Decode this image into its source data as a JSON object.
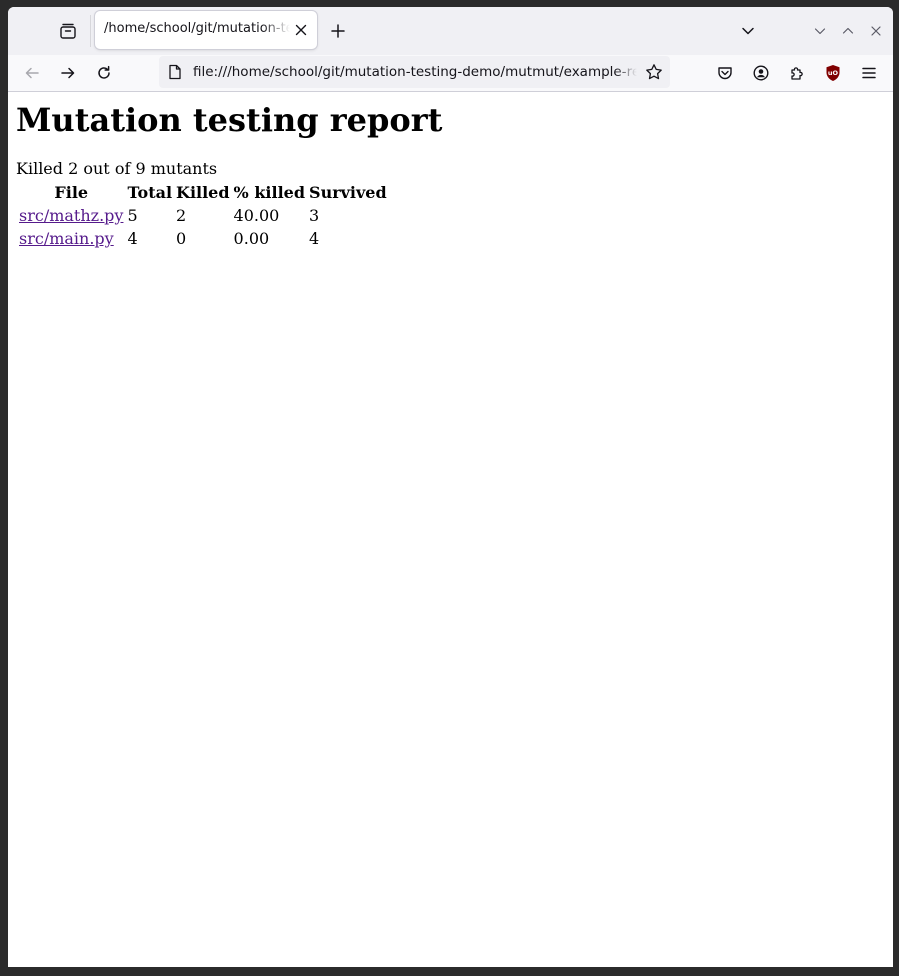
{
  "browser": {
    "tab": {
      "title": "/home/school/git/mutation-testing-demo/mutmut/example-report.html"
    },
    "url": "file:///home/school/git/mutation-testing-demo/mutmut/example-report.html",
    "colors": {
      "tab_strip_bg": "#f0f0f4",
      "toolbar_bg": "#f9f9fb",
      "ublock_red": "#800000",
      "link_visited": "#551a8b"
    }
  },
  "page": {
    "heading": "Mutation testing report",
    "summary": "Killed 2 out of 9 mutants",
    "table": {
      "headers": {
        "file": "File",
        "total": "Total",
        "killed": "Killed",
        "pct": "% killed",
        "survived": "Survived"
      },
      "rows": [
        {
          "file": "src/mathz.py",
          "total": "5",
          "killed": "2",
          "pct": "40.00",
          "survived": "3"
        },
        {
          "file": "src/main.py",
          "total": "4",
          "killed": "0",
          "pct": "0.00",
          "survived": "4"
        }
      ]
    }
  },
  "icons": {
    "tab_overview": "firefox-view-icon",
    "tab_close": "close-icon",
    "new_tab": "plus-icon",
    "tab_list": "chevron-down-icon",
    "back": "back-arrow-icon",
    "forward": "forward-arrow-icon",
    "reload": "reload-icon",
    "page_info": "file-page-icon",
    "bookmark": "star-icon",
    "pocket": "pocket-icon",
    "account": "account-icon",
    "extensions": "puzzle-icon",
    "ublock": "ublock-origin-icon",
    "menu": "hamburger-menu-icon",
    "minimize": "minimize-icon",
    "maximize": "maximize-icon",
    "close_window": "close-window-icon"
  }
}
